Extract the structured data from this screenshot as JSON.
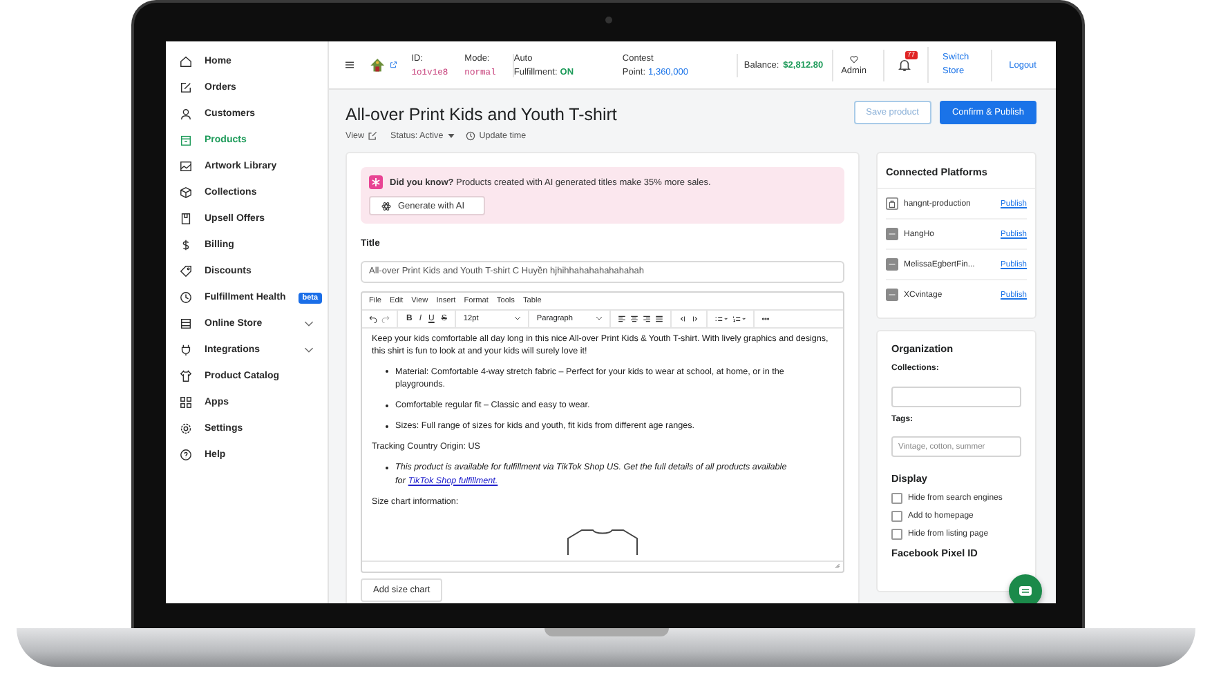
{
  "sidebar": {
    "items": [
      {
        "label": "Home",
        "kind": "link",
        "selected": false
      },
      {
        "label": "Orders",
        "kind": "link",
        "selected": false
      },
      {
        "label": "Customers",
        "kind": "link",
        "selected": false
      },
      {
        "label": "Products",
        "kind": "link",
        "selected": true
      },
      {
        "label": "Artwork Library",
        "kind": "link",
        "selected": false
      },
      {
        "label": "Collections",
        "kind": "link",
        "selected": false
      },
      {
        "label": "Upsell Offers",
        "kind": "link",
        "selected": false
      },
      {
        "label": "Billing",
        "kind": "link",
        "selected": false
      },
      {
        "label": "Discounts",
        "kind": "link",
        "selected": false
      },
      {
        "label": "Fulfillment Health",
        "kind": "link",
        "selected": false,
        "badge": "beta"
      },
      {
        "label": "Online Store",
        "kind": "group",
        "selected": false,
        "expanded": false
      },
      {
        "label": "Integrations",
        "kind": "group",
        "selected": false,
        "expanded": false
      },
      {
        "label": "Product Catalog",
        "kind": "link",
        "selected": false
      },
      {
        "label": "Apps",
        "kind": "link",
        "selected": false
      },
      {
        "label": "Settings",
        "kind": "link",
        "selected": false
      },
      {
        "label": "Help",
        "kind": "link",
        "selected": false
      }
    ]
  },
  "topbar": {
    "id_label": "ID:",
    "id_value": "1o1v1e8",
    "mode_label": "Mode:",
    "mode_value": "normal",
    "auto_line1": "Auto",
    "auto_line2": "Fulfillment:",
    "auto_value": "ON",
    "contest_line1": "Contest",
    "contest_line2": "Point:",
    "contest_value": "1,360,000",
    "balance_label": "Balance:",
    "balance_value": "$2,812.80",
    "admin": "Admin",
    "notification_count": "77",
    "switch_store": "Switch Store",
    "logout": "Logout"
  },
  "page": {
    "title": "All-over Print Kids and Youth T-shirt",
    "view": "View",
    "status": "Status: Active",
    "update_time": "Update time",
    "save_button": "Save product",
    "publish_button": "Confirm & Publish"
  },
  "ai_tip": {
    "text": "**Did you know?** Products created with AI generated titles make 35% more sales.",
    "button": "Generate with AI"
  },
  "title_field": {
    "label": "Title",
    "value": "All-over Print Kids and Youth T-shirt C Huyền hjhihhahahahahahahah"
  },
  "editor": {
    "menu": [
      "File",
      "Edit",
      "View",
      "Insert",
      "Format",
      "Tools",
      "Table"
    ],
    "format_buttons": [
      "B",
      "I",
      "U",
      "S"
    ],
    "font_size": "12pt",
    "block_format": "Paragraph",
    "content": [
      {
        "kind": "paragraph",
        "text": "Keep your kids comfortable all day long in this nice All-over Print Kids & Youth T-shirt. With lively graphics and designs, this shirt is fun to look at and your kids will surely love it!"
      },
      {
        "kind": "bullets",
        "italic": false,
        "items": [
          {
            "text": "Material: Comfortable 4-way stretch fabric – Perfect for your kids to wear at school, at home, or in the playgrounds."
          },
          {
            "text": "Comfortable regular fit – Classic and easy to wear."
          },
          {
            "text": "Sizes: Full range of sizes for kids and youth, fit kids from different age ranges."
          }
        ]
      },
      {
        "kind": "paragraph",
        "text": "Tracking Country Origin: US"
      },
      {
        "kind": "bullets",
        "italic": true,
        "items": [
          {
            "text": "This product is available for fulfillment via TikTok Shop US. Get the full details of all products available for",
            "link": "TikTok Shop fulfillment."
          }
        ]
      },
      {
        "kind": "paragraph",
        "text": "Size chart information:"
      },
      {
        "kind": "image"
      }
    ]
  },
  "size_chart_button": "Add size chart",
  "platforms": {
    "title": "Connected Platforms",
    "items": [
      {
        "name": "hangnt-production",
        "action": "Publish"
      },
      {
        "name": "HangHo",
        "action": "Publish"
      },
      {
        "name": "MelissaEgbertFin...",
        "action": "Publish"
      },
      {
        "name": "XCvintage",
        "action": "Publish"
      }
    ]
  },
  "organization": {
    "title": "Organization",
    "collections_label": "Collections:",
    "tags_label": "Tags:",
    "tags_placeholder": "Vintage, cotton, summer",
    "display_title": "Display",
    "options": [
      {
        "label": "Hide from search engines",
        "checked": false
      },
      {
        "label": "Add to homepage",
        "checked": false
      },
      {
        "label": "Hide from listing page",
        "checked": false
      }
    ],
    "pixel_title": "Facebook Pixel ID"
  }
}
